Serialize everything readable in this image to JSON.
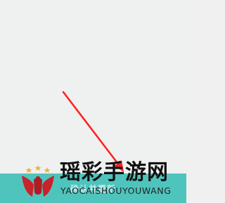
{
  "confirm_button": {
    "label": "确认并更新"
  },
  "watermark": {
    "title": "瑶彩手游网",
    "subtitle": "YAOCAISHOUYOUWANG"
  },
  "colors": {
    "background": "#eff0f0",
    "button_bg": "#4fc4bd",
    "arrow": "#ff1f1f"
  }
}
